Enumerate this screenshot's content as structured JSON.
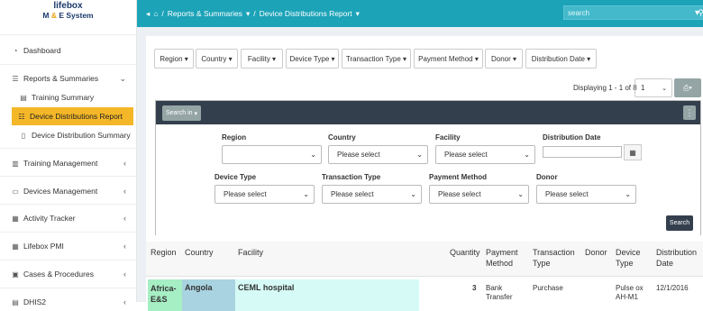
{
  "app": {
    "logo_top": "lifebox",
    "logo_m": "M",
    "logo_amp": "&",
    "logo_e": "E System"
  },
  "sidebar": {
    "items": [
      {
        "label": "Dashboard",
        "icon": "dashboard-icon"
      },
      {
        "label": "Reports & Summaries",
        "icon": "list-icon"
      },
      {
        "label": "Training Summary",
        "icon": "book-icon"
      },
      {
        "label": "Device Distributions Report",
        "icon": "table-icon"
      },
      {
        "label": "Device Distribution Summary",
        "icon": "mobile-icon"
      },
      {
        "label": "Training Management",
        "icon": "training-icon"
      },
      {
        "label": "Devices Management",
        "icon": "monitor-icon"
      },
      {
        "label": "Activity Tracker",
        "icon": "activity-icon"
      },
      {
        "label": "Lifebox PMI",
        "icon": "grid-icon"
      },
      {
        "label": "Cases & Procedures",
        "icon": "briefcase-icon"
      },
      {
        "label": "DHIS2",
        "icon": "database-icon"
      }
    ],
    "active_color": "#f4b728"
  },
  "topbar": {
    "home_icon": "home-icon",
    "breadcrumb_sep": "/",
    "crumb1": "Reports & Summaries",
    "crumb2": "Device Distributions Report",
    "search_placeholder": "search",
    "bg_color": "#1ca3b8"
  },
  "filters": {
    "buttons": [
      "Region",
      "Country",
      "Facility",
      "Device Type",
      "Transaction Type",
      "Payment Method",
      "Donor",
      "Distribution Date"
    ]
  },
  "pagination": {
    "displaying": "Displaying 1 - 1 of 8",
    "page_value": "1"
  },
  "search_panel": {
    "search_in_label": "Search in",
    "region_label": "Region",
    "region_value": "",
    "country_label": "Country",
    "country_value": "Please select",
    "facility_label": "Facility",
    "facility_value": "Please select",
    "date_label": "Distribution Date",
    "device_label": "Device Type",
    "device_value": "Please select",
    "transaction_label": "Transaction Type",
    "transaction_value": "Please select",
    "payment_label": "Payment Method",
    "payment_value": "Please select",
    "donor_label": "Donor",
    "donor_value": "Please select",
    "search_button": "Search"
  },
  "table": {
    "headers": {
      "region": "Region",
      "country": "Country",
      "facility": "Facility",
      "quantity": "Quantity",
      "payment_1": "Payment",
      "payment_2": "Method",
      "transaction_1": "Transaction",
      "transaction_2": "Type",
      "donor": "Donor",
      "device_1": "Device",
      "device_2": "Type",
      "date_1": "Distribution",
      "date_2": "Date"
    },
    "row": {
      "region_1": "Africa-",
      "region_2": "E&S",
      "country": "Angola",
      "facility": "CEML hospital",
      "quantity": "3",
      "payment_1": "Bank",
      "payment_2": "Transfer",
      "transaction": "Purchase",
      "donor": "",
      "device_1": "Pulse ox",
      "device_2": "AH-M1",
      "date": "12/1/2016"
    },
    "colors": {
      "region_bg": "#a6eec4",
      "country_bg": "#a9d3e0",
      "facility_bg": "#d6fbf6"
    }
  }
}
